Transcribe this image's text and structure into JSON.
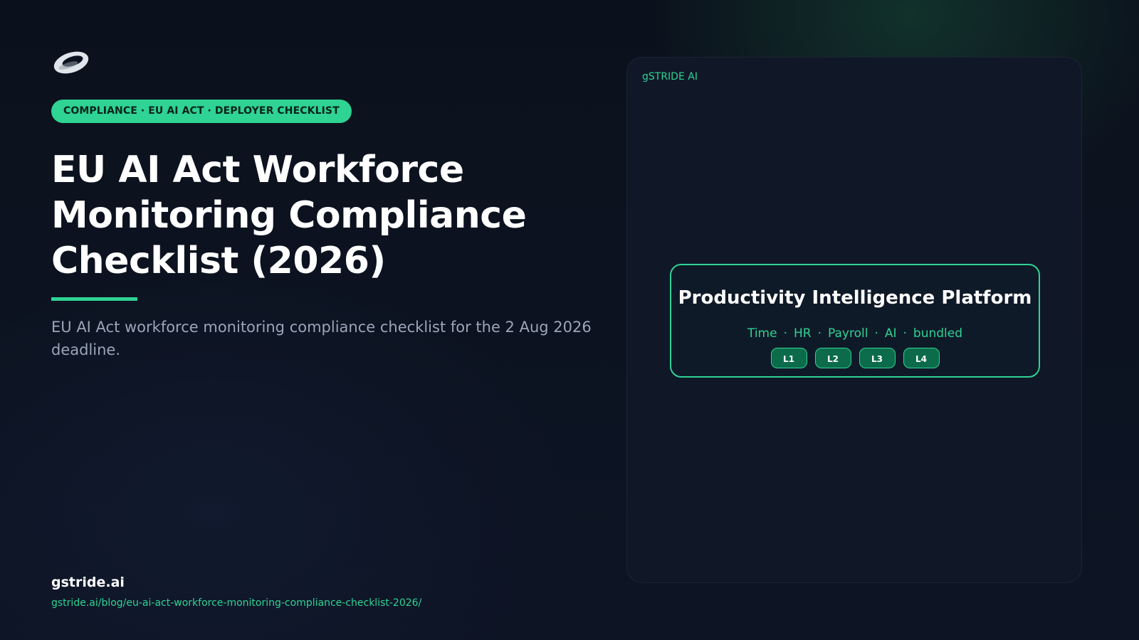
{
  "badge": "COMPLIANCE · EU AI ACT · DEPLOYER CHECKLIST",
  "title": "EU AI Act Workforce Monitoring Compliance Checklist (2026)",
  "subtitle": "EU AI Act workforce monitoring compliance checklist for the 2 Aug 2026 deadline.",
  "footer": {
    "domain": "gstride.ai",
    "url": "gstride.ai/blog/eu-ai-act-workforce-monitoring-compliance-checklist-2026/"
  },
  "panel": {
    "brand": "gSTRIDE AI",
    "card": {
      "title": "Productivity Intelligence Platform",
      "tags": [
        "Time",
        "HR",
        "Payroll",
        "AI",
        "bundled"
      ],
      "tag_separator": "·",
      "levels": [
        "L1",
        "L2",
        "L3",
        "L4"
      ]
    }
  },
  "icons": {
    "logo": "gstride-ring-logo"
  },
  "colors": {
    "accent": "#2fd394",
    "background": "#0c1220",
    "panel": "#101828",
    "level_chip": "#0b6b4a"
  }
}
